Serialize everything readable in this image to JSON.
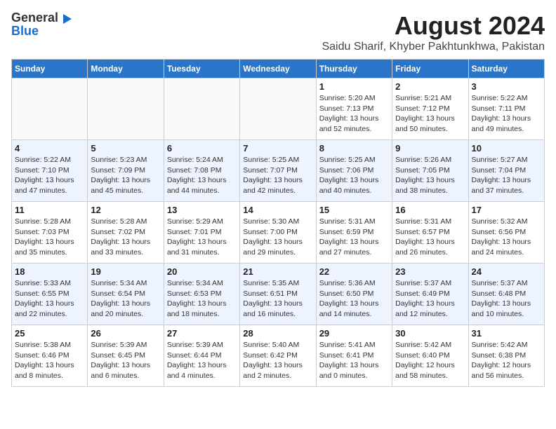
{
  "header": {
    "logo_general": "General",
    "logo_blue": "Blue",
    "title": "August 2024",
    "subtitle": "Saidu Sharif, Khyber Pakhtunkhwa, Pakistan"
  },
  "weekdays": [
    "Sunday",
    "Monday",
    "Tuesday",
    "Wednesday",
    "Thursday",
    "Friday",
    "Saturday"
  ],
  "weeks": [
    [
      {
        "day": "",
        "info": ""
      },
      {
        "day": "",
        "info": ""
      },
      {
        "day": "",
        "info": ""
      },
      {
        "day": "",
        "info": ""
      },
      {
        "day": "1",
        "sunrise": "Sunrise: 5:20 AM",
        "sunset": "Sunset: 7:13 PM",
        "daylight": "Daylight: 13 hours and 52 minutes."
      },
      {
        "day": "2",
        "sunrise": "Sunrise: 5:21 AM",
        "sunset": "Sunset: 7:12 PM",
        "daylight": "Daylight: 13 hours and 50 minutes."
      },
      {
        "day": "3",
        "sunrise": "Sunrise: 5:22 AM",
        "sunset": "Sunset: 7:11 PM",
        "daylight": "Daylight: 13 hours and 49 minutes."
      }
    ],
    [
      {
        "day": "4",
        "sunrise": "Sunrise: 5:22 AM",
        "sunset": "Sunset: 7:10 PM",
        "daylight": "Daylight: 13 hours and 47 minutes."
      },
      {
        "day": "5",
        "sunrise": "Sunrise: 5:23 AM",
        "sunset": "Sunset: 7:09 PM",
        "daylight": "Daylight: 13 hours and 45 minutes."
      },
      {
        "day": "6",
        "sunrise": "Sunrise: 5:24 AM",
        "sunset": "Sunset: 7:08 PM",
        "daylight": "Daylight: 13 hours and 44 minutes."
      },
      {
        "day": "7",
        "sunrise": "Sunrise: 5:25 AM",
        "sunset": "Sunset: 7:07 PM",
        "daylight": "Daylight: 13 hours and 42 minutes."
      },
      {
        "day": "8",
        "sunrise": "Sunrise: 5:25 AM",
        "sunset": "Sunset: 7:06 PM",
        "daylight": "Daylight: 13 hours and 40 minutes."
      },
      {
        "day": "9",
        "sunrise": "Sunrise: 5:26 AM",
        "sunset": "Sunset: 7:05 PM",
        "daylight": "Daylight: 13 hours and 38 minutes."
      },
      {
        "day": "10",
        "sunrise": "Sunrise: 5:27 AM",
        "sunset": "Sunset: 7:04 PM",
        "daylight": "Daylight: 13 hours and 37 minutes."
      }
    ],
    [
      {
        "day": "11",
        "sunrise": "Sunrise: 5:28 AM",
        "sunset": "Sunset: 7:03 PM",
        "daylight": "Daylight: 13 hours and 35 minutes."
      },
      {
        "day": "12",
        "sunrise": "Sunrise: 5:28 AM",
        "sunset": "Sunset: 7:02 PM",
        "daylight": "Daylight: 13 hours and 33 minutes."
      },
      {
        "day": "13",
        "sunrise": "Sunrise: 5:29 AM",
        "sunset": "Sunset: 7:01 PM",
        "daylight": "Daylight: 13 hours and 31 minutes."
      },
      {
        "day": "14",
        "sunrise": "Sunrise: 5:30 AM",
        "sunset": "Sunset: 7:00 PM",
        "daylight": "Daylight: 13 hours and 29 minutes."
      },
      {
        "day": "15",
        "sunrise": "Sunrise: 5:31 AM",
        "sunset": "Sunset: 6:59 PM",
        "daylight": "Daylight: 13 hours and 27 minutes."
      },
      {
        "day": "16",
        "sunrise": "Sunrise: 5:31 AM",
        "sunset": "Sunset: 6:57 PM",
        "daylight": "Daylight: 13 hours and 26 minutes."
      },
      {
        "day": "17",
        "sunrise": "Sunrise: 5:32 AM",
        "sunset": "Sunset: 6:56 PM",
        "daylight": "Daylight: 13 hours and 24 minutes."
      }
    ],
    [
      {
        "day": "18",
        "sunrise": "Sunrise: 5:33 AM",
        "sunset": "Sunset: 6:55 PM",
        "daylight": "Daylight: 13 hours and 22 minutes."
      },
      {
        "day": "19",
        "sunrise": "Sunrise: 5:34 AM",
        "sunset": "Sunset: 6:54 PM",
        "daylight": "Daylight: 13 hours and 20 minutes."
      },
      {
        "day": "20",
        "sunrise": "Sunrise: 5:34 AM",
        "sunset": "Sunset: 6:53 PM",
        "daylight": "Daylight: 13 hours and 18 minutes."
      },
      {
        "day": "21",
        "sunrise": "Sunrise: 5:35 AM",
        "sunset": "Sunset: 6:51 PM",
        "daylight": "Daylight: 13 hours and 16 minutes."
      },
      {
        "day": "22",
        "sunrise": "Sunrise: 5:36 AM",
        "sunset": "Sunset: 6:50 PM",
        "daylight": "Daylight: 13 hours and 14 minutes."
      },
      {
        "day": "23",
        "sunrise": "Sunrise: 5:37 AM",
        "sunset": "Sunset: 6:49 PM",
        "daylight": "Daylight: 13 hours and 12 minutes."
      },
      {
        "day": "24",
        "sunrise": "Sunrise: 5:37 AM",
        "sunset": "Sunset: 6:48 PM",
        "daylight": "Daylight: 13 hours and 10 minutes."
      }
    ],
    [
      {
        "day": "25",
        "sunrise": "Sunrise: 5:38 AM",
        "sunset": "Sunset: 6:46 PM",
        "daylight": "Daylight: 13 hours and 8 minutes."
      },
      {
        "day": "26",
        "sunrise": "Sunrise: 5:39 AM",
        "sunset": "Sunset: 6:45 PM",
        "daylight": "Daylight: 13 hours and 6 minutes."
      },
      {
        "day": "27",
        "sunrise": "Sunrise: 5:39 AM",
        "sunset": "Sunset: 6:44 PM",
        "daylight": "Daylight: 13 hours and 4 minutes."
      },
      {
        "day": "28",
        "sunrise": "Sunrise: 5:40 AM",
        "sunset": "Sunset: 6:42 PM",
        "daylight": "Daylight: 13 hours and 2 minutes."
      },
      {
        "day": "29",
        "sunrise": "Sunrise: 5:41 AM",
        "sunset": "Sunset: 6:41 PM",
        "daylight": "Daylight: 13 hours and 0 minutes."
      },
      {
        "day": "30",
        "sunrise": "Sunrise: 5:42 AM",
        "sunset": "Sunset: 6:40 PM",
        "daylight": "Daylight: 12 hours and 58 minutes."
      },
      {
        "day": "31",
        "sunrise": "Sunrise: 5:42 AM",
        "sunset": "Sunset: 6:38 PM",
        "daylight": "Daylight: 12 hours and 56 minutes."
      }
    ]
  ]
}
